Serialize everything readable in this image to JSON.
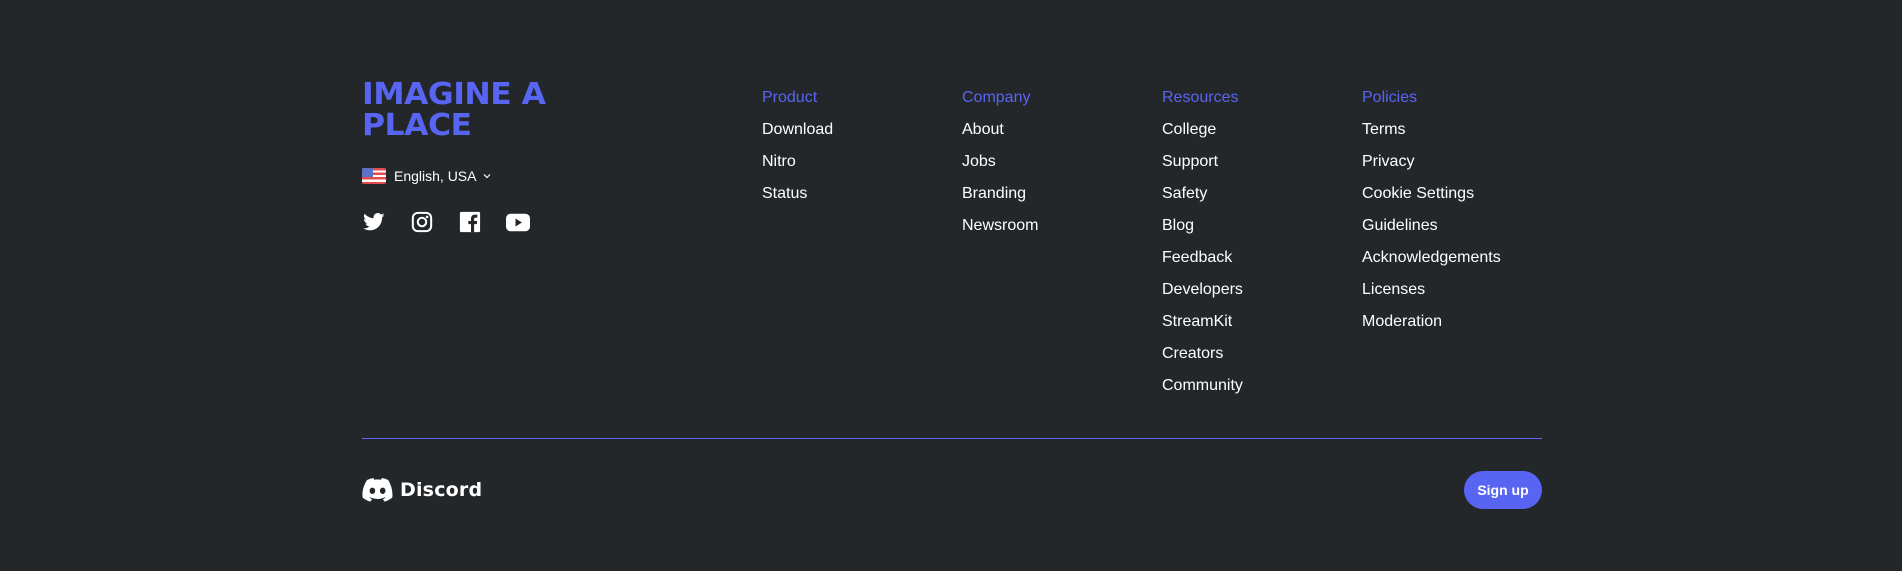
{
  "brand": {
    "tagline": "IMAGINE A PLACE",
    "language": "English, USA",
    "accent_color": "#5865f2",
    "background_color": "#23272a"
  },
  "socials": [
    {
      "icon": "twitter-icon"
    },
    {
      "icon": "instagram-icon"
    },
    {
      "icon": "facebook-icon"
    },
    {
      "icon": "youtube-icon"
    }
  ],
  "columns": [
    {
      "heading": "Product",
      "links": [
        "Download",
        "Nitro",
        "Status"
      ]
    },
    {
      "heading": "Company",
      "links": [
        "About",
        "Jobs",
        "Branding",
        "Newsroom"
      ]
    },
    {
      "heading": "Resources",
      "links": [
        "College",
        "Support",
        "Safety",
        "Blog",
        "Feedback",
        "Developers",
        "StreamKit",
        "Creators",
        "Community"
      ]
    },
    {
      "heading": "Policies",
      "links": [
        "Terms",
        "Privacy",
        "Cookie Settings",
        "Guidelines",
        "Acknowledgements",
        "Licenses",
        "Moderation"
      ]
    }
  ],
  "bottom": {
    "logo_text": "Discord",
    "signup_label": "Sign up"
  }
}
